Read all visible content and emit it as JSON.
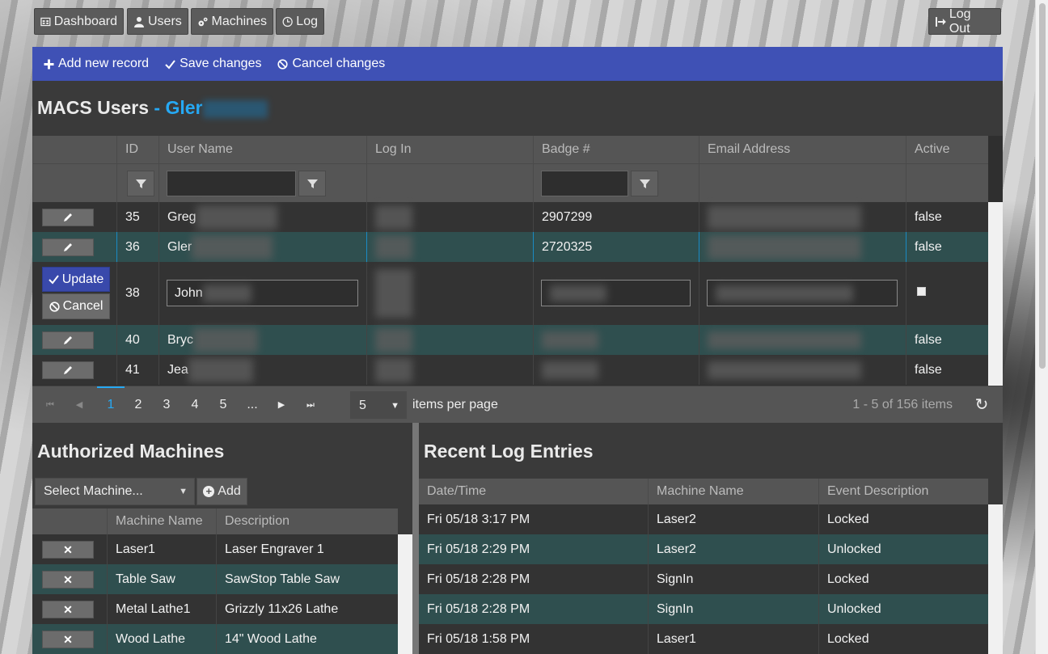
{
  "nav": {
    "dashboard": "Dashboard",
    "users": "Users",
    "machines": "Machines",
    "log": "Log",
    "logout": "Log Out"
  },
  "toolbar": {
    "add": "Add new record",
    "save": "Save changes",
    "cancel": "Cancel changes"
  },
  "title": {
    "main": "MACS Users",
    "accent": " - Gler"
  },
  "users_grid": {
    "columns": [
      "ID",
      "User Name",
      "Log In",
      "Badge #",
      "Email Address",
      "Active"
    ],
    "rows": [
      {
        "id": "35",
        "name": "Greg",
        "badge": "2907299",
        "active": "false"
      },
      {
        "id": "36",
        "name": "Gler",
        "badge": "2720325",
        "active": "false"
      },
      {
        "id": "38",
        "name": "John",
        "badge": "",
        "active": ""
      },
      {
        "id": "40",
        "name": "Bryc",
        "badge": "",
        "active": "false"
      },
      {
        "id": "41",
        "name": "Jea",
        "badge": "",
        "active": "false"
      }
    ],
    "update_label": "Update",
    "cancel_label": "Cancel"
  },
  "pager": {
    "pages": [
      "1",
      "2",
      "3",
      "4",
      "5",
      "..."
    ],
    "page_size": "5",
    "per_page_label": "items per page",
    "summary": "1 - 5 of 156 items"
  },
  "machines": {
    "title": "Authorized Machines",
    "select_placeholder": "Select Machine...",
    "add_label": "Add",
    "columns": [
      "Machine Name",
      "Description"
    ],
    "rows": [
      {
        "name": "Laser1",
        "desc": "Laser Engraver 1"
      },
      {
        "name": "Table Saw",
        "desc": "SawStop Table Saw"
      },
      {
        "name": "Metal Lathe1",
        "desc": "Grizzly 11x26 Lathe"
      },
      {
        "name": "Wood Lathe",
        "desc": "14\" Wood Lathe"
      }
    ]
  },
  "log": {
    "title": "Recent Log Entries",
    "columns": [
      "Date/Time",
      "Machine Name",
      "Event Description"
    ],
    "rows": [
      {
        "dt": "Fri 05/18 3:17 PM",
        "machine": "Laser2",
        "event": "Locked"
      },
      {
        "dt": "Fri 05/18 2:29 PM",
        "machine": "Laser2",
        "event": "Unlocked"
      },
      {
        "dt": "Fri 05/18 2:28 PM",
        "machine": "SignIn",
        "event": "Locked"
      },
      {
        "dt": "Fri 05/18 2:28 PM",
        "machine": "SignIn",
        "event": "Unlocked"
      },
      {
        "dt": "Fri 05/18 1:58 PM",
        "machine": "Laser1",
        "event": "Locked"
      }
    ]
  },
  "colors": {
    "accent": "#26a9f4",
    "toolbar": "#3f51b5",
    "row_alt": "#2f4f4f"
  }
}
